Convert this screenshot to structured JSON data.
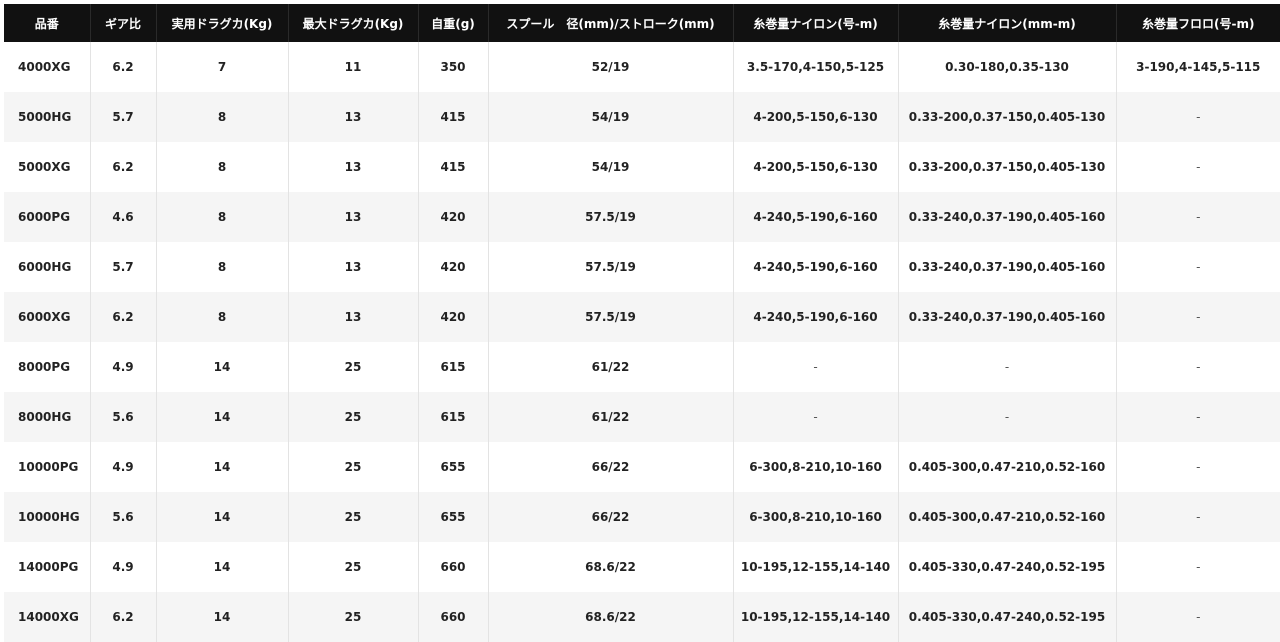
{
  "table": {
    "headers": [
      "品番",
      "ギア比",
      "実用ドラグカ(Kg)",
      "最大ドラグカ(Kg)",
      "自重(g)",
      "スプール　径(mm)/ストローク(mm)",
      "糸巻量ナイロン(号-m)",
      "糸巻量ナイロン(mm-m)",
      "糸巻量フロロ(号-m)"
    ],
    "rows": [
      [
        "4000XG",
        "6.2",
        "7",
        "11",
        "350",
        "52/19",
        "3.5-170,4-150,5-125",
        "0.30-180,0.35-130",
        "3-190,4-145,5-115"
      ],
      [
        "5000HG",
        "5.7",
        "8",
        "13",
        "415",
        "54/19",
        "4-200,5-150,6-130",
        "0.33-200,0.37-150,0.405-130",
        "-"
      ],
      [
        "5000XG",
        "6.2",
        "8",
        "13",
        "415",
        "54/19",
        "4-200,5-150,6-130",
        "0.33-200,0.37-150,0.405-130",
        "-"
      ],
      [
        "6000PG",
        "4.6",
        "8",
        "13",
        "420",
        "57.5/19",
        "4-240,5-190,6-160",
        "0.33-240,0.37-190,0.405-160",
        "-"
      ],
      [
        "6000HG",
        "5.7",
        "8",
        "13",
        "420",
        "57.5/19",
        "4-240,5-190,6-160",
        "0.33-240,0.37-190,0.405-160",
        "-"
      ],
      [
        "6000XG",
        "6.2",
        "8",
        "13",
        "420",
        "57.5/19",
        "4-240,5-190,6-160",
        "0.33-240,0.37-190,0.405-160",
        "-"
      ],
      [
        "8000PG",
        "4.9",
        "14",
        "25",
        "615",
        "61/22",
        "-",
        "-",
        "-"
      ],
      [
        "8000HG",
        "5.6",
        "14",
        "25",
        "615",
        "61/22",
        "-",
        "-",
        "-"
      ],
      [
        "10000PG",
        "4.9",
        "14",
        "25",
        "655",
        "66/22",
        "6-300,8-210,10-160",
        "0.405-300,0.47-210,0.52-160",
        "-"
      ],
      [
        "10000HG",
        "5.6",
        "14",
        "25",
        "655",
        "66/22",
        "6-300,8-210,10-160",
        "0.405-300,0.47-210,0.52-160",
        "-"
      ],
      [
        "14000PG",
        "4.9",
        "14",
        "25",
        "660",
        "68.6/22",
        "10-195,12-155,14-140",
        "0.405-330,0.47-240,0.52-195",
        "-"
      ],
      [
        "14000XG",
        "6.2",
        "14",
        "25",
        "660",
        "68.6/22",
        "10-195,12-155,14-140",
        "0.405-330,0.47-240,0.52-195",
        "-"
      ]
    ]
  }
}
